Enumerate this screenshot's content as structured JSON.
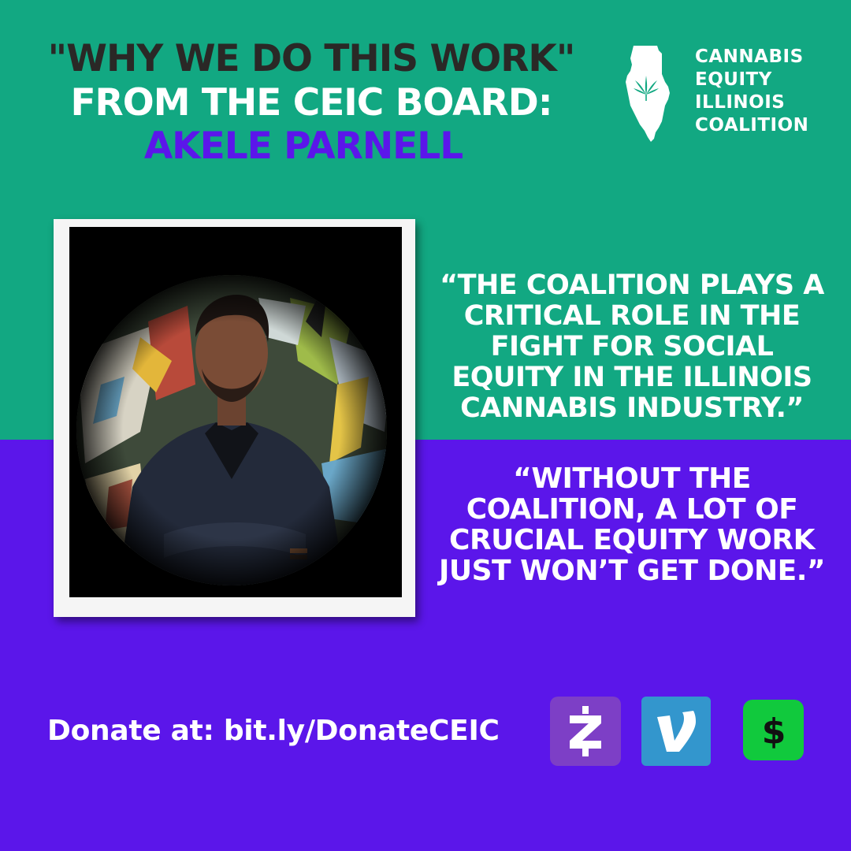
{
  "headline": {
    "line1": "\"WHY WE DO THIS WORK\"",
    "line2": "FROM THE CEIC BOARD:",
    "line3": "AKELE PARNELL"
  },
  "logo": {
    "icon": "illinois-state-cannabis-leaf-icon",
    "lines": [
      "CANNABIS",
      "EQUITY",
      "ILLINOIS",
      "COALITION"
    ]
  },
  "photo": {
    "subject": "portrait-photo"
  },
  "quotes": [
    {
      "lines": [
        "“THE COALITION PLAYS A",
        "CRITICAL ROLE IN THE",
        "FIGHT FOR SOCIAL",
        "EQUITY IN THE ILLINOIS",
        "CANNABIS INDUSTRY.”"
      ]
    },
    {
      "lines": [
        "“WITHOUT THE",
        "COALITION, A LOT OF",
        "CRUCIAL EQUITY WORK",
        "JUST WON’T GET DONE.”"
      ]
    }
  ],
  "donate": {
    "text": "Donate at: bit.ly/DonateCEIC"
  },
  "payment_icons": [
    {
      "name": "zelle-icon",
      "glyph": "Z",
      "color": "#7d3fc6"
    },
    {
      "name": "venmo-icon",
      "glyph": "V",
      "color": "#3396cd"
    },
    {
      "name": "cash-app-icon",
      "glyph": "$",
      "color": "#11c93d"
    }
  ],
  "colors": {
    "green": "#12a882",
    "purple": "#5b16ea",
    "dark": "#2a2826"
  }
}
